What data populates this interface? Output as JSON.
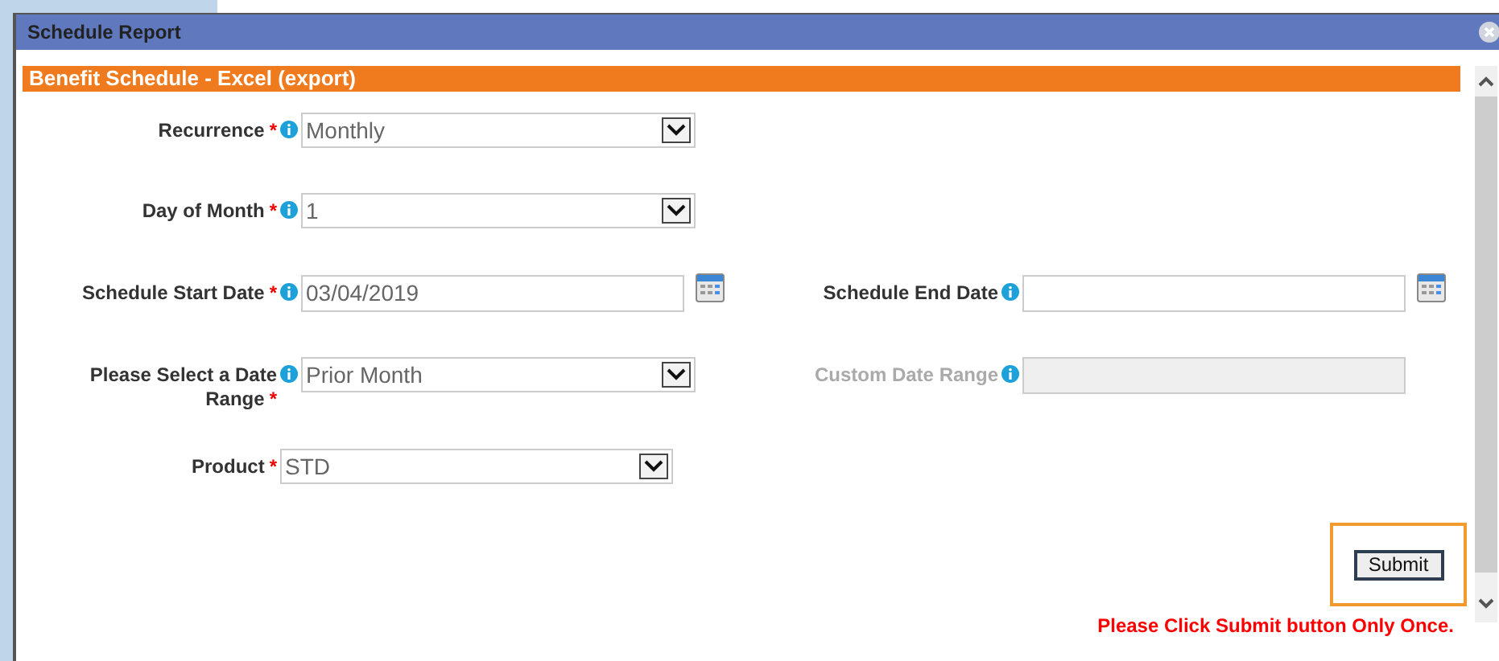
{
  "window": {
    "title": "Schedule Report"
  },
  "section": {
    "title": "Benefit Schedule - Excel (export)"
  },
  "rows": [
    [
      {
        "kind": "select",
        "label": "Recurrence",
        "marker": "*",
        "info": true,
        "value": "Monthly"
      }
    ],
    [
      {
        "kind": "select",
        "label": "Day of Month",
        "marker": "*",
        "info": true,
        "value": "1"
      }
    ],
    [
      {
        "kind": "date",
        "label": "Schedule Start Date",
        "marker": "*",
        "info": true,
        "value": "03/04/2019"
      },
      {
        "kind": "date",
        "label": "Schedule End Date",
        "info": true
      }
    ],
    [
      {
        "kind": "select",
        "label": "Please Select a Date Range",
        "marker": "*",
        "info": true,
        "value": "Prior Month"
      },
      {
        "kind": "text",
        "label": "Custom Date Range",
        "info": true,
        "disabled": true
      }
    ],
    [
      {
        "kind": "select",
        "label": "Product",
        "marker": "*",
        "info": false,
        "value": "STD"
      }
    ]
  ],
  "submit": {
    "label": "Submit",
    "highlighted": true
  },
  "notice": "Please Click Submit button Only Once."
}
